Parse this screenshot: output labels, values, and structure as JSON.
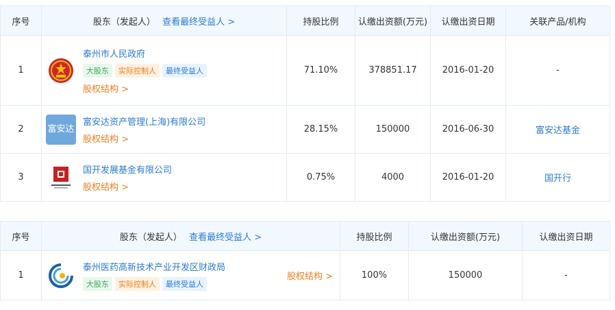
{
  "table1": {
    "headers": {
      "index": "序号",
      "holder": "股东（发起人）",
      "view_beneficiary": "查看最终受益人 >",
      "ratio": "持股比例",
      "amount": "认缴出资额(万元)",
      "date": "认缴出资日期",
      "related": "关联产品/机构"
    },
    "rows": [
      {
        "index": "1",
        "name": "泰州市人民政府",
        "logo_icon": "national-emblem-icon",
        "tags": [
          "大股东",
          "实际控制人",
          "最终受益人"
        ],
        "equity_link": "股权结构 >",
        "ratio": "71.10%",
        "amount": "378851.17",
        "date": "2016-01-20",
        "related": "-"
      },
      {
        "index": "2",
        "name": "富安达资产管理(上海)有限公司",
        "logo_text": "富安达",
        "equity_link": "股权结构 >",
        "ratio": "28.15%",
        "amount": "150000",
        "date": "2016-06-30",
        "related": "富安达基金"
      },
      {
        "index": "3",
        "name": "国开发展基金有限公司",
        "logo_icon": "cdb-logo-icon",
        "equity_link": "股权结构 >",
        "ratio": "0.75%",
        "amount": "4000",
        "date": "2016-01-20",
        "related": "国开行"
      }
    ]
  },
  "table2": {
    "headers": {
      "index": "序号",
      "holder": "股东（发起人）",
      "view_beneficiary": "查看最终受益人 >",
      "ratio": "持股比例",
      "amount": "认缴出资额(万元)",
      "date": "认缴出资日期"
    },
    "rows": [
      {
        "index": "1",
        "name": "泰州医药高新技术产业开发区财政局",
        "logo_icon": "swirl-logo-icon",
        "tags": [
          "大股东",
          "实际控制人",
          "最终受益人"
        ],
        "equity_link": "股权结构 >",
        "ratio": "100%",
        "amount": "150000",
        "date": "-"
      }
    ]
  },
  "colors": {
    "header_bg": "#f2f8ff",
    "link_blue": "#2a7bd6",
    "orange": "#f07c1d",
    "green": "#3fa65a"
  }
}
